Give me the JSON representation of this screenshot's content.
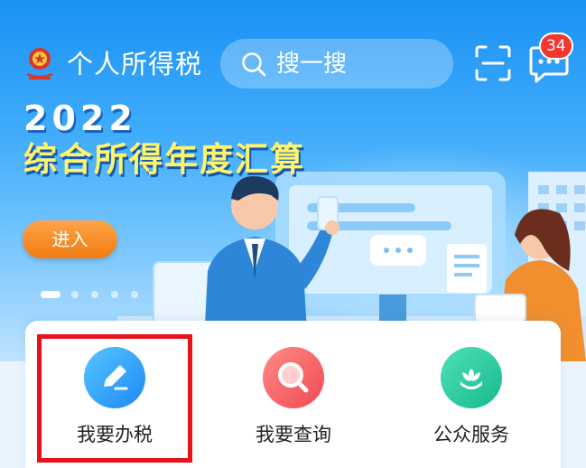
{
  "header": {
    "app_title": "个人所得税",
    "search_placeholder": "搜一搜",
    "message_badge": "34",
    "icons": [
      "emblem-icon",
      "search-icon",
      "scan-icon",
      "message-icon"
    ]
  },
  "banner": {
    "year": "2022",
    "title": "综合所得年度汇算",
    "enter_label": "进入",
    "carousel_dots": 5,
    "active_dot": 0
  },
  "services": [
    {
      "label": "我要办税",
      "icon": "pencil-icon",
      "color_from": "#56c6ff",
      "color_to": "#1e88f5"
    },
    {
      "label": "我要查询",
      "icon": "magnifier-icon",
      "color_from": "#ff8a86",
      "color_to": "#f04a52"
    },
    {
      "label": "公众服务",
      "icon": "flower-icon",
      "color_from": "#4ee0b9",
      "color_to": "#18b98e"
    }
  ],
  "colors": {
    "banner_top": "#1a91f4",
    "promo_yellow": "#fff46a",
    "enter_orange": "#f17b12",
    "badge_red": "#f5362c",
    "highlight_red": "#e8111a"
  }
}
